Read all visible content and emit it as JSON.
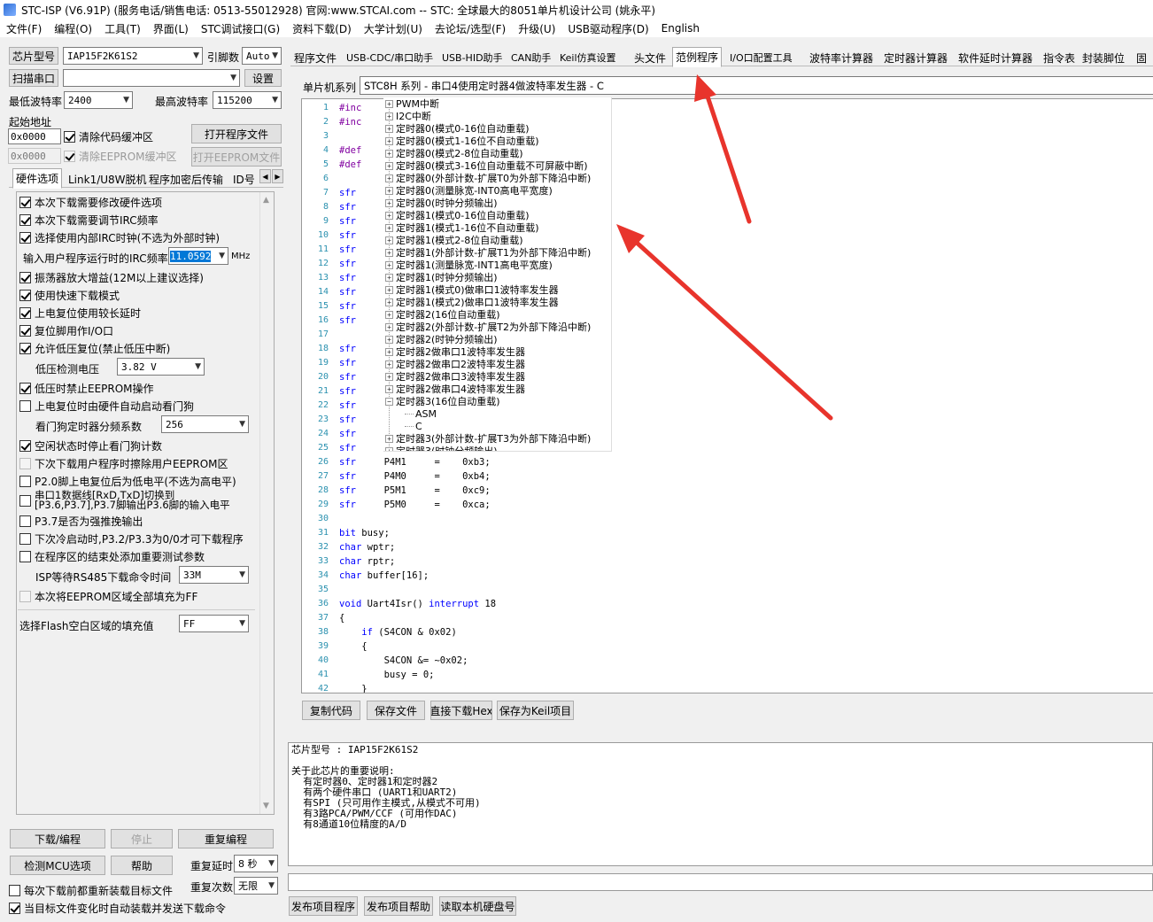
{
  "window_title": "STC-ISP (V6.91P) (服务电话/销售电话: 0513-55012928) 官网:www.STCAI.com  -- STC: 全球最大的8051单片机设计公司 (姚永平)",
  "menu": [
    "文件(F)",
    "编程(O)",
    "工具(T)",
    "界面(L)",
    "STC调试接口(G)",
    "资料下载(D)",
    "大学计划(U)",
    "去论坛/选型(F)",
    "升级(U)",
    "USB驱动程序(D)",
    "English"
  ],
  "left": {
    "chip_model_btn": "芯片型号",
    "chip_model_value": "IAP15F2K61S2",
    "pins_label": "引脚数",
    "pins_value": "Auto",
    "scan_port_btn": "扫描串口",
    "port_value": "",
    "settings_btn": "设置",
    "min_baud_label": "最低波特率",
    "min_baud_value": "2400",
    "max_baud_label": "最高波特率",
    "max_baud_value": "115200",
    "start_addr_label": "起始地址",
    "start_addr_value": "0x0000",
    "clear_code_buf": "清除代码缓冲区",
    "open_prog_btn": "打开程序文件",
    "eeprom_addr_value": "0x0000",
    "clear_eeprom_buf": "清除EEPROM缓冲区",
    "open_eeprom_btn": "打开EEPROM文件"
  },
  "left_tabs": [
    "硬件选项",
    "Link1/U8W脱机",
    "程序加密后传输",
    "ID号"
  ],
  "hw_options": [
    {
      "label": "本次下载需要修改硬件选项",
      "checked": true
    },
    {
      "label": "本次下载需要调节IRC频率",
      "checked": true
    },
    {
      "label": "选择使用内部IRC时钟(不选为外部时钟)",
      "checked": true
    },
    {
      "label": "输入用户程序运行时的IRC频率",
      "freq": "11.0592",
      "unit": "MHz"
    },
    {
      "label": "振荡器放大增益(12M以上建议选择)",
      "checked": true
    },
    {
      "label": "使用快速下载模式",
      "checked": true
    },
    {
      "label": "上电复位使用较长延时",
      "checked": true
    },
    {
      "label": "复位脚用作I/O口",
      "checked": true
    },
    {
      "label": "允许低压复位(禁止低压中断)",
      "checked": true
    },
    {
      "label": "低压检测电压",
      "value": "3.82 V"
    },
    {
      "label": "低压时禁止EEPROM操作",
      "checked": true
    },
    {
      "label": "上电复位时由硬件自动启动看门狗",
      "checked": false
    },
    {
      "label": "看门狗定时器分频系数",
      "value": "256"
    },
    {
      "label": "空闲状态时停止看门狗计数",
      "checked": true
    },
    {
      "label": "下次下载用户程序时擦除用户EEPROM区",
      "checked": false,
      "disabled": true
    },
    {
      "label": "P2.0脚上电复位后为低电平(不选为高电平)",
      "checked": false
    },
    {
      "label": "串口1数据线[RxD,TxD]切换到",
      "label2": "[P3.6,P3.7],P3.7脚输出P3.6脚的输入电平",
      "checked": false
    },
    {
      "label": "P3.7是否为强推挽输出",
      "checked": false
    },
    {
      "label": "下次冷启动时,P3.2/P3.3为0/0才可下载程序",
      "checked": false
    },
    {
      "label": "在程序区的结束处添加重要测试参数",
      "checked": false
    },
    {
      "label": "ISP等待RS485下载命令时间",
      "value": "33M"
    },
    {
      "label": "本次将EEPROM区域全部填充为FF",
      "checked": false,
      "disabled": true
    },
    {
      "label": "选择Flash空白区域的填充值",
      "value": "FF"
    }
  ],
  "bottom_left": {
    "download_btn": "下载/编程",
    "stop_btn": "停止",
    "reprogram_btn": "重复编程",
    "check_mcu_btn": "检测MCU选项",
    "help_btn": "帮助",
    "repeat_delay_label": "重复延时",
    "repeat_delay_value": "8 秒",
    "repeat_count_label": "重复次数",
    "repeat_count_value": "无限",
    "reload_each": "每次下载前都重新装载目标文件",
    "auto_send": "当目标文件变化时自动装载并发送下载命令"
  },
  "top_tabs": [
    "程序文件",
    "USB-CDC/串口助手",
    "USB-HID助手",
    "CAN助手",
    "Keil仿真设置",
    "头文件",
    "范例程序",
    "I/O口配置工具",
    "波特率计算器",
    "定时器计算器",
    "软件延时计算器",
    "指令表",
    "封装脚位",
    "固"
  ],
  "active_tab": "范例程序",
  "example": {
    "series_label": "单片机系列",
    "combo_value": "STC8H 系列 - 串口4使用定时器4做波特率发生器 - C"
  },
  "code_lines": [
    {
      "n": "1",
      "t": "#inc"
    },
    {
      "n": "2",
      "t": "#inc"
    },
    {
      "n": "3",
      "t": ""
    },
    {
      "n": "4",
      "t": "#def"
    },
    {
      "n": "5",
      "t": "#def"
    },
    {
      "n": "6",
      "t": ""
    },
    {
      "n": "7",
      "t": "sfr"
    },
    {
      "n": "8",
      "t": "sfr"
    },
    {
      "n": "9",
      "t": "sfr"
    },
    {
      "n": "10",
      "t": "sfr"
    },
    {
      "n": "11",
      "t": "sfr"
    },
    {
      "n": "12",
      "t": "sfr"
    },
    {
      "n": "13",
      "t": "sfr"
    },
    {
      "n": "14",
      "t": "sfr"
    },
    {
      "n": "15",
      "t": "sfr"
    },
    {
      "n": "16",
      "t": "sfr"
    },
    {
      "n": "17",
      "t": ""
    },
    {
      "n": "18",
      "t": "sfr"
    },
    {
      "n": "19",
      "t": "sfr"
    },
    {
      "n": "20",
      "t": "sfr"
    },
    {
      "n": "21",
      "t": "sfr"
    },
    {
      "n": "22",
      "t": "sfr"
    },
    {
      "n": "23",
      "t": "sfr"
    },
    {
      "n": "24",
      "t": "sfr"
    },
    {
      "n": "25",
      "t": "sfr"
    },
    {
      "n": "26",
      "t": "sfr     P4M1     =    0xb3;"
    },
    {
      "n": "27",
      "t": "sfr     P4M0     =    0xb4;"
    },
    {
      "n": "28",
      "t": "sfr     P5M1     =    0xc9;"
    },
    {
      "n": "29",
      "t": "sfr     P5M0     =    0xca;"
    },
    {
      "n": "30",
      "t": ""
    },
    {
      "n": "31",
      "t": "bit busy;"
    },
    {
      "n": "32",
      "t": "char wptr;"
    },
    {
      "n": "33",
      "t": "char rptr;"
    },
    {
      "n": "34",
      "t": "char buffer[16];"
    },
    {
      "n": "35",
      "t": ""
    },
    {
      "n": "36",
      "t": "void Uart4Isr() interrupt 18"
    },
    {
      "n": "37",
      "t": "{"
    },
    {
      "n": "38",
      "t": "    if (S4CON & 0x02)"
    },
    {
      "n": "39",
      "t": "    {"
    },
    {
      "n": "40",
      "t": "        S4CON &= ~0x02;"
    },
    {
      "n": "41",
      "t": "        busy = 0;"
    },
    {
      "n": "42",
      "t": "    }"
    }
  ],
  "tree_items": [
    "PWM中断",
    "I2C中断",
    "定时器0(模式0-16位自动重载)",
    "定时器0(模式1-16位不自动重载)",
    "定时器0(模式2-8位自动重载)",
    "定时器0(模式3-16位自动重载不可屏蔽中断)",
    "定时器0(外部计数-扩展T0为外部下降沿中断)",
    "定时器0(测量脉宽-INT0高电平宽度)",
    "定时器0(时钟分频输出)",
    "定时器1(模式0-16位自动重载)",
    "定时器1(模式1-16位不自动重载)",
    "定时器1(模式2-8位自动重载)",
    "定时器1(外部计数-扩展T1为外部下降沿中断)",
    "定时器1(测量脉宽-INT1高电平宽度)",
    "定时器1(时钟分频输出)",
    "定时器1(模式0)做串口1波特率发生器",
    "定时器1(模式2)做串口1波特率发生器",
    "定时器2(16位自动重载)",
    "定时器2(外部计数-扩展T2为外部下降沿中断)",
    "定时器2(时钟分频输出)",
    "定时器2做串口1波特率发生器",
    "定时器2做串口2波特率发生器",
    "定时器2做串口3波特率发生器",
    "定时器2做串口4波特率发生器",
    "定时器3(16位自动重载)"
  ],
  "tree_children": [
    "ASM",
    "C"
  ],
  "tree_after": [
    "定时器3(外部计数-扩展T3为外部下降沿中断)",
    "定时器3(时钟分频输出)"
  ],
  "code_buttons": {
    "copy": "复制代码",
    "save": "保存文件",
    "download_hex": "直接下载Hex",
    "save_keil": "保存为Keil项目"
  },
  "info_text": "芯片型号 : IAP15F2K61S2\n\n关于此芯片的重要说明:\n  有定时器0、定时器1和定时器2\n  有两个硬件串口 (UART1和UART2)\n  有SPI (只可用作主模式,从模式不可用)\n  有3路PCA/PWM/CCF (可用作DAC)\n  有8通道10位精度的A/D",
  "bottom_buttons": {
    "publish": "发布项目程序",
    "publish_help": "发布项目帮助",
    "read_disk": "读取本机硬盘号"
  },
  "colors": {
    "arrow": "#e8342c",
    "selection": "#0078d7"
  }
}
